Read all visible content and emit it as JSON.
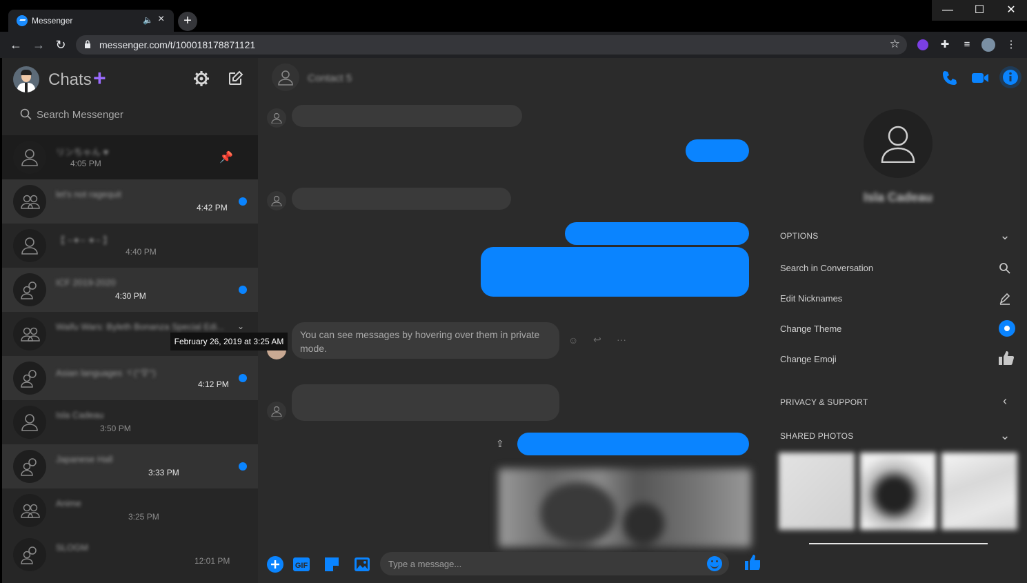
{
  "browser": {
    "tab_title": "Messenger",
    "url": "messenger.com/t/100018178871121",
    "new_tab": "+",
    "close_tab": "×"
  },
  "sidebar": {
    "title": "Chats",
    "search_placeholder": "Search Messenger",
    "chats": [
      {
        "name": "リンちゃん ♥",
        "time": "4:05 PM",
        "unread": false,
        "group": false,
        "pinned": true
      },
      {
        "name": "let's not ragequit",
        "time": "4:42 PM",
        "unread": true,
        "group": true
      },
      {
        "name": "【 ~✦~ ✦~ 】",
        "time": "4:40 PM",
        "unread": false,
        "group": false
      },
      {
        "name": "ICF 2019-2020",
        "time": "4:30 PM",
        "unread": true,
        "group": true
      },
      {
        "name": "Waifu Wars: Byleth Bonanza Special Edi...",
        "time": "",
        "unread": false,
        "group": true
      },
      {
        "name": "Asian languages ヾ(°∇°)",
        "time": "4:12 PM",
        "unread": true,
        "group": true
      },
      {
        "name": "Isla Cadeau",
        "time": "3:50 PM",
        "unread": false,
        "group": false
      },
      {
        "name": "Japanese Hall",
        "time": "3:33 PM",
        "unread": true,
        "group": true
      },
      {
        "name": "Anime",
        "time": "3:25 PM",
        "unread": false,
        "group": true
      },
      {
        "name": "SLOGM",
        "time": "12:01 PM",
        "unread": false,
        "group": true
      }
    ],
    "tooltip": "February 26, 2019 at 3:25 AM"
  },
  "conversation": {
    "contact_name": "Contact 5",
    "private_notice": "You can see messages by hovering over them in private mode.",
    "input_placeholder": "Type a message..."
  },
  "details": {
    "profile_name": "Isla Cadeau",
    "options_header": "OPTIONS",
    "options": [
      "Search in Conversation",
      "Edit Nicknames",
      "Change Theme",
      "Change Emoji"
    ],
    "privacy_header": "PRIVACY & SUPPORT",
    "photos_header": "SHARED PHOTOS"
  },
  "colors": {
    "accent": "#0a84ff",
    "plus": "#9b6bff",
    "bg": "#2b2b2b"
  }
}
